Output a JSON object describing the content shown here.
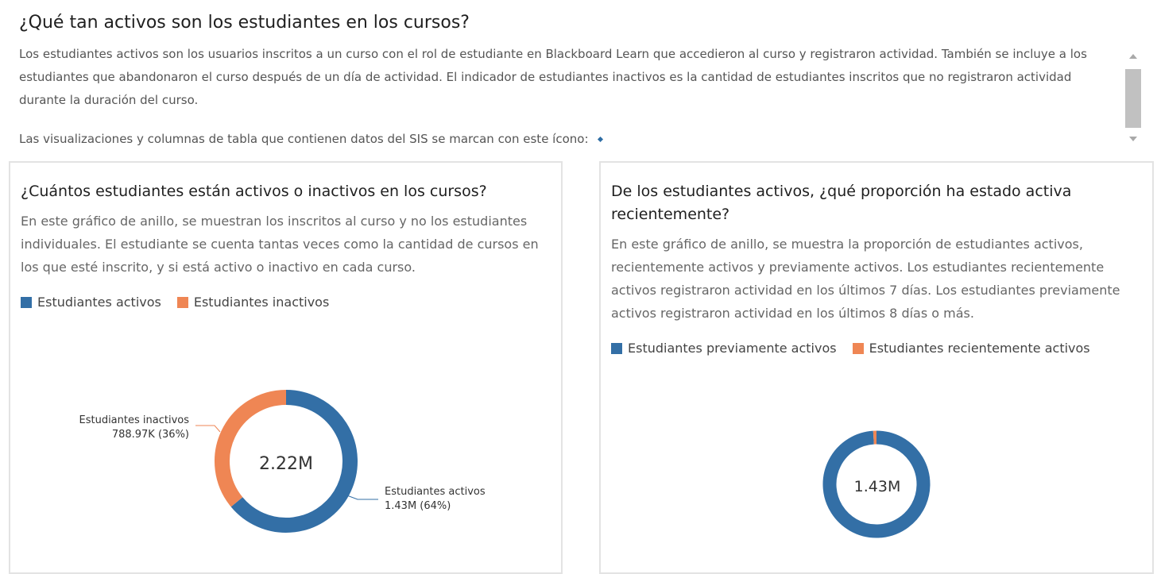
{
  "header": {
    "title": "¿Qué tan activos son los estudiantes en los cursos?",
    "description": "Los estudiantes activos son los usuarios inscritos a un curso con el rol de estudiante en Blackboard Learn que accedieron al curso y registraron actividad. También se incluye a los estudiantes que abandonaron el curso después de un día de actividad. El indicador de estudiantes inactivos es la cantidad de estudiantes inscritos que no registraron actividad durante la duración del curso.",
    "sis_note": "Las visualizaciones y columnas de tabla que contienen datos del SIS se marcan con este ícono:"
  },
  "colors": {
    "blue": "#336fa6",
    "orange": "#ef8654"
  },
  "left_card": {
    "title": "¿Cuántos estudiantes están activos o inactivos en los cursos?",
    "description": "En este gráfico de anillo, se muestran los inscritos al curso y no los estudiantes individuales. El estudiante se cuenta tantas veces como la cantidad de cursos en los que esté inscrito, y si está activo o inactivo en cada curso.",
    "legend": [
      {
        "label": "Estudiantes activos"
      },
      {
        "label": "Estudiantes inactivos"
      }
    ]
  },
  "right_card": {
    "title": "De los estudiantes activos, ¿qué proporción ha estado activa recientemente?",
    "description": "En este gráfico de anillo, se muestra la proporción de estudiantes activos, recientemente activos y previamente activos. Los estudiantes recientemente activos registraron actividad en los últimos 7 días. Los estudiantes previamente activos registraron actividad en los últimos 8 días o más.",
    "legend": [
      {
        "label": "Estudiantes previamente activos"
      },
      {
        "label": "Estudiantes recientemente activos"
      }
    ]
  },
  "chart_data": [
    {
      "type": "pie",
      "center_label": "2.22M",
      "categories": [
        "Estudiantes activos",
        "Estudiantes inactivos"
      ],
      "values": [
        1430000,
        788970
      ],
      "percent": [
        64,
        36
      ],
      "data_labels": [
        {
          "name": "Estudiantes activos",
          "value": "1.43M (64%)"
        },
        {
          "name": "Estudiantes inactivos",
          "value": "788.97K (36%)"
        }
      ],
      "legend": "top-left"
    },
    {
      "type": "pie",
      "center_label": "1.43M",
      "categories": [
        "Estudiantes previamente activos",
        "Estudiantes recientemente activos"
      ],
      "percent": [
        99,
        1
      ],
      "legend": "top-left"
    }
  ]
}
